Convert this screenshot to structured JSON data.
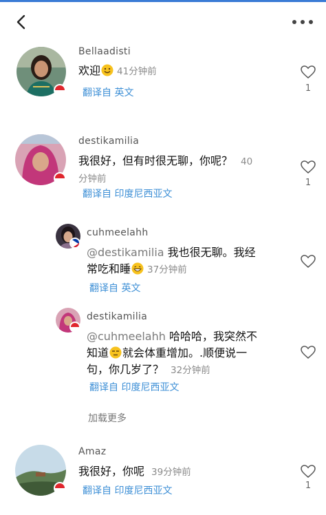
{
  "header": {
    "back_icon": "chevron-left-icon",
    "more_icon": "more-dots-icon",
    "accent_color": "#3a7bd5"
  },
  "comments": [
    {
      "username": "Bellaadisti",
      "text": "欢迎",
      "emoji": "smile-emoji",
      "time": "41分钟前",
      "translate": "翻译自 英文",
      "likes": "1",
      "flag": "indonesia"
    },
    {
      "username": "destikamilia",
      "text_line1": "我很好，但有时很无聊，你呢？",
      "time_part1": "40",
      "time_part2": "分钟前",
      "translate": "翻译自 印度尼西亚文",
      "likes": "1",
      "flag": "indonesia"
    }
  ],
  "replies": [
    {
      "username": "cuhmeelahh",
      "mention": "@destikamilia",
      "text_line1": " 我也很无聊。我经",
      "text_line2": "常吃和睡",
      "emoji": "grin-emoji",
      "time": "37分钟前",
      "translate": "翻译自 英文",
      "flag": "philippines"
    },
    {
      "username": "destikamilia",
      "mention": "@cuhmeelahh",
      "text_line1": " 哈哈哈，我突然不",
      "text_line2a": "知道",
      "emoji": "unamused-emoji",
      "text_line2b": "就会体重增加。.顺便说一",
      "text_line3": "句，你几岁了？",
      "time": "32分钟前",
      "translate": "翻译自 印度尼西亚文",
      "flag": "indonesia"
    }
  ],
  "load_more": "加载更多",
  "last_comment": {
    "username": "Amaz",
    "text": "我很好，你呢",
    "time": "39分钟前",
    "translate": "翻译自 印度尼西亚文",
    "likes": "1",
    "flag": "indonesia"
  }
}
